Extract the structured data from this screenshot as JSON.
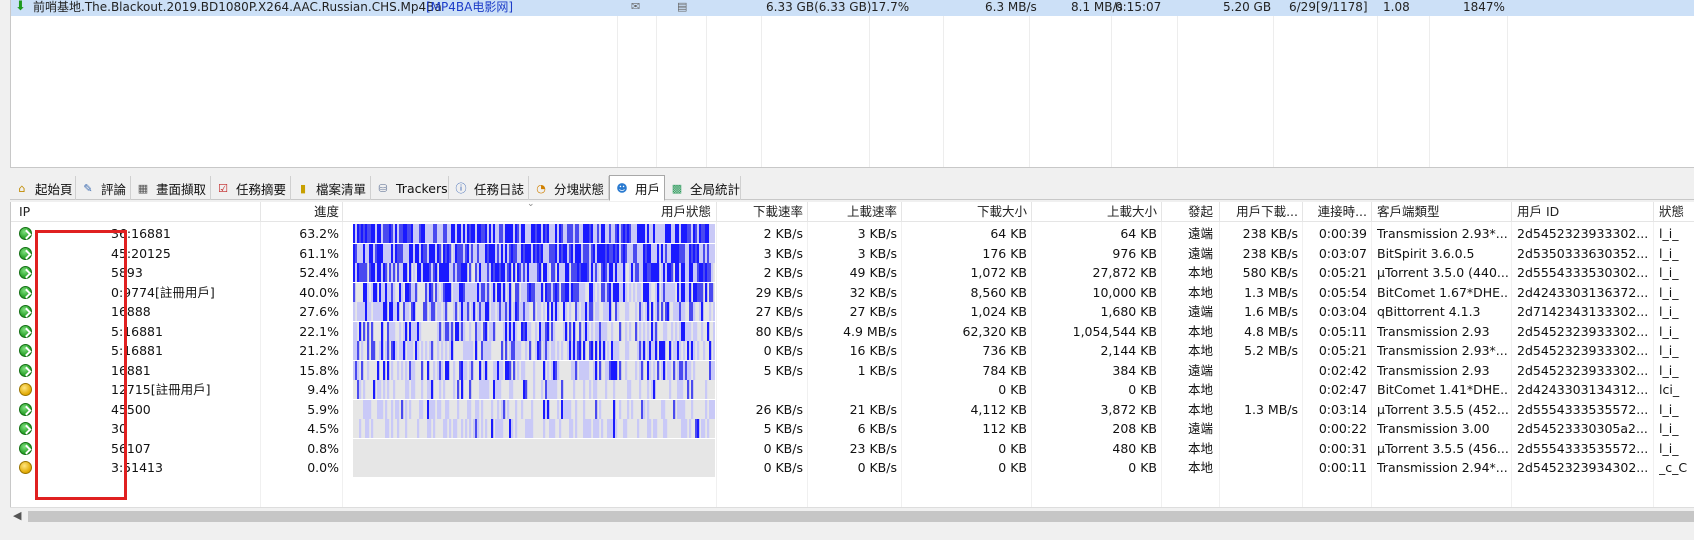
{
  "task": {
    "name": "前哨基地.The.Blackout.2019.BD1080P.X264.AAC.Russian.CHS.Mp4Ba",
    "tag": "[MP4BA电影网]",
    "size": "6.33 GB(6.33 GB)",
    "progress": "17.7%",
    "down_speed": "6.3 MB/s",
    "up_speed": "8.1 MB/s",
    "time": "0:15:07",
    "uploaded": "5.20 GB",
    "peers": "6/29[9/1178]",
    "ratio": "1.08",
    "health": "1847%"
  },
  "tabs": [
    {
      "label": "起始頁",
      "icon": "home-icon"
    },
    {
      "label": "評論",
      "icon": "comment-icon"
    },
    {
      "label": "畫面擷取",
      "icon": "screenshot-icon"
    },
    {
      "label": "任務摘要",
      "icon": "summary-icon"
    },
    {
      "label": "檔案清單",
      "icon": "file-list-icon"
    },
    {
      "label": "Trackers",
      "icon": "tracker-icon"
    },
    {
      "label": "任務日誌",
      "icon": "info-icon"
    },
    {
      "label": "分塊狀態",
      "icon": "pie-icon"
    },
    {
      "label": "用戶",
      "icon": "user-icon"
    },
    {
      "label": "全局統計",
      "icon": "stats-icon"
    }
  ],
  "active_tab": "用戶",
  "columns": {
    "ip": "IP",
    "progress": "進度",
    "status": "用戶狀態",
    "down": "下載速率",
    "up": "上載速率",
    "down_size": "下載大小",
    "up_size": "上載大小",
    "initiator": "發起",
    "user_down": "用戶下載...",
    "conn_time": "連接時...",
    "client": "客戶端類型",
    "uid": "用戶 ID",
    "state": "狀態"
  },
  "peers": [
    {
      "ip": "36:16881",
      "progress": "63.2%",
      "pct": 63.2,
      "down": "2 KB/s",
      "up": "3 KB/s",
      "down_size": "64 KB",
      "up_size": "64 KB",
      "initiator": "遠端",
      "user_down": "238 KB/s",
      "time": "0:00:39",
      "client": "Transmission 2.93*...",
      "uid": "2d5452323933302...",
      "state": "l_i_",
      "icon": "green"
    },
    {
      "ip": "45:20125",
      "progress": "61.1%",
      "pct": 61.1,
      "down": "3 KB/s",
      "up": "3 KB/s",
      "down_size": "176 KB",
      "up_size": "976 KB",
      "initiator": "遠端",
      "user_down": "238 KB/s",
      "time": "0:03:07",
      "client": "BitSpirit 3.6.0.5",
      "uid": "2d5350333630352...",
      "state": "l_i_",
      "icon": "green"
    },
    {
      "ip": "5893",
      "progress": "52.4%",
      "pct": 52.4,
      "down": "2 KB/s",
      "up": "49 KB/s",
      "down_size": "1,072 KB",
      "up_size": "27,872 KB",
      "initiator": "本地",
      "user_down": "580 KB/s",
      "time": "0:05:21",
      "client": "µTorrent 3.5.0 (440...",
      "uid": "2d5554333530302...",
      "state": "l_i_",
      "icon": "green"
    },
    {
      "ip": "0:9774[註冊用戶]",
      "progress": "40.0%",
      "pct": 40.0,
      "down": "29 KB/s",
      "up": "32 KB/s",
      "down_size": "8,560 KB",
      "up_size": "10,000 KB",
      "initiator": "本地",
      "user_down": "1.3 MB/s",
      "time": "0:05:54",
      "client": "BitComet 1.67*DHE...",
      "uid": "2d4243303136372...",
      "state": "l_i_",
      "icon": "green"
    },
    {
      "ip": "16888",
      "progress": "27.6%",
      "pct": 27.6,
      "down": "27 KB/s",
      "up": "27 KB/s",
      "down_size": "1,024 KB",
      "up_size": "1,680 KB",
      "initiator": "遠端",
      "user_down": "1.6 MB/s",
      "time": "0:03:04",
      "client": "qBittorrent 4.1.3",
      "uid": "2d7142343133302...",
      "state": "l_i_",
      "icon": "green"
    },
    {
      "ip": "5:16881",
      "progress": "22.1%",
      "pct": 22.1,
      "down": "80 KB/s",
      "up": "4.9 MB/s",
      "down_size": "62,320 KB",
      "up_size": "1,054,544 KB",
      "initiator": "本地",
      "user_down": "4.8 MB/s",
      "time": "0:05:11",
      "client": "Transmission 2.93",
      "uid": "2d5452323933302...",
      "state": "l_i_",
      "icon": "green"
    },
    {
      "ip": "5:16881",
      "progress": "21.2%",
      "pct": 21.2,
      "down": "0 KB/s",
      "up": "16 KB/s",
      "down_size": "736 KB",
      "up_size": "2,144 KB",
      "initiator": "本地",
      "user_down": "5.2 MB/s",
      "time": "0:05:21",
      "client": "Transmission 2.93*...",
      "uid": "2d5452323933302...",
      "state": "l_i_",
      "icon": "green"
    },
    {
      "ip": "16881",
      "progress": "15.8%",
      "pct": 15.8,
      "down": "5 KB/s",
      "up": "1 KB/s",
      "down_size": "784 KB",
      "up_size": "384 KB",
      "initiator": "遠端",
      "user_down": "",
      "time": "0:02:42",
      "client": "Transmission 2.93",
      "uid": "2d5452323933302...",
      "state": "l_i_",
      "icon": "green"
    },
    {
      "ip": "12715[註冊用戶]",
      "progress": "9.4%",
      "pct": 9.4,
      "down": "",
      "up": "",
      "down_size": "0 KB",
      "up_size": "0 KB",
      "initiator": "本地",
      "user_down": "",
      "time": "0:02:47",
      "client": "BitComet 1.41*DHE...",
      "uid": "2d4243303134312...",
      "state": "lci_",
      "icon": "yellow"
    },
    {
      "ip": "45500",
      "progress": "5.9%",
      "pct": 5.9,
      "down": "26 KB/s",
      "up": "21 KB/s",
      "down_size": "4,112 KB",
      "up_size": "3,872 KB",
      "initiator": "本地",
      "user_down": "1.3 MB/s",
      "time": "0:03:14",
      "client": "µTorrent 3.5.5 (452...",
      "uid": "2d5554333535572...",
      "state": "l_i_",
      "icon": "green"
    },
    {
      "ip": "30",
      "progress": "4.5%",
      "pct": 4.5,
      "down": "5 KB/s",
      "up": "6 KB/s",
      "down_size": "112 KB",
      "up_size": "208 KB",
      "initiator": "遠端",
      "user_down": "",
      "time": "0:00:22",
      "client": "Transmission 3.00",
      "uid": "2d54523330305a2...",
      "state": "l_i_",
      "icon": "green"
    },
    {
      "ip": "56107",
      "progress": "0.8%",
      "pct": 0.8,
      "down": "0 KB/s",
      "up": "23 KB/s",
      "down_size": "0 KB",
      "up_size": "480 KB",
      "initiator": "本地",
      "user_down": "",
      "time": "0:00:31",
      "client": "µTorrent 3.5.5 (456...",
      "uid": "2d5554333535572...",
      "state": "l_i_",
      "icon": "green"
    },
    {
      "ip": "3:51413",
      "progress": "0.0%",
      "pct": 0.0,
      "down": "0 KB/s",
      "up": "0 KB/s",
      "down_size": "0 KB",
      "up_size": "0 KB",
      "initiator": "本地",
      "user_down": "",
      "time": "0:00:11",
      "client": "Transmission 2.94*...",
      "uid": "2d5452323934302...",
      "state": "_c_C",
      "icon": "yellow"
    }
  ],
  "colors": {
    "bar_blue": "#1a1aff",
    "bar_light": "#c9c9f7",
    "bar_bg": "#e6e6e6",
    "selection": "#cce0f7",
    "redaction": "#e02020"
  }
}
